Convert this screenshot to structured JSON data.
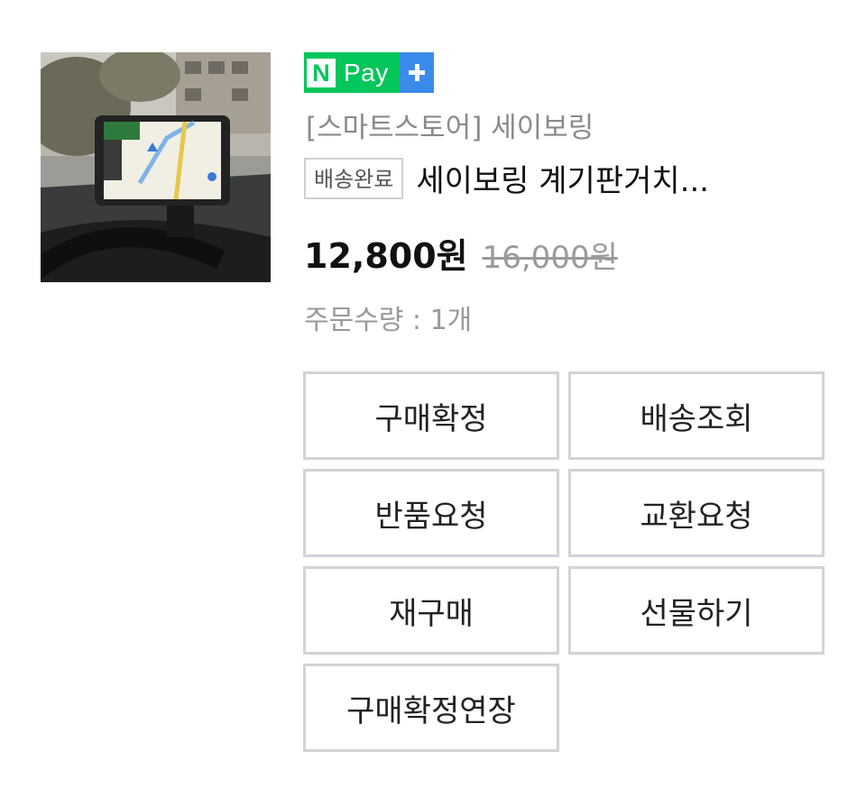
{
  "badge": {
    "pay_n": "N",
    "pay_text": "Pay"
  },
  "order": {
    "store": "[스마트스토어] 세이보링",
    "status": "배송완료",
    "product_name": "세이보링 계기판거치...",
    "price": "12,800원",
    "original_price": "16,000원",
    "quantity": "주문수량 : 1개"
  },
  "actions": {
    "confirm": "구매확정",
    "track": "배송조회",
    "return": "반품요청",
    "exchange": "교환요청",
    "rebuy": "재구매",
    "gift": "선물하기",
    "extend": "구매확정연장"
  },
  "colors": {
    "npay_green": "#03c75a",
    "npay_blue": "#3b8beb",
    "button_border": "#d2d2d8"
  }
}
